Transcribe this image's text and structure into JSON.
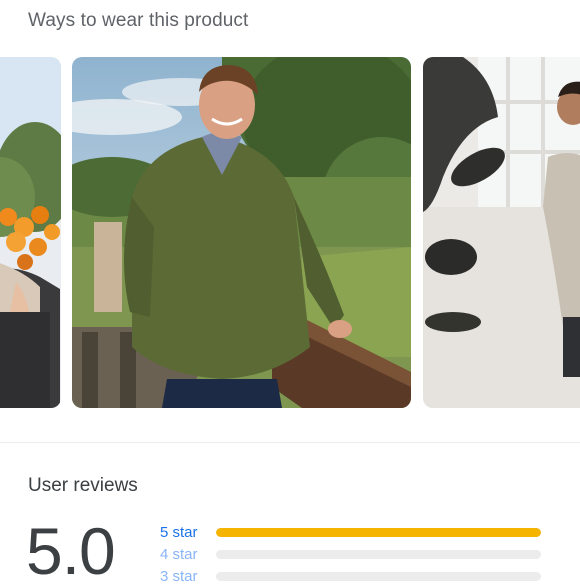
{
  "ways_section": {
    "title": "Ways to wear this product",
    "cards": [
      {
        "subject": "man-seated-with-orange-flowers"
      },
      {
        "subject": "man-in-green-fleece-by-fence"
      },
      {
        "subject": "man-in-white-room-with-plant"
      }
    ]
  },
  "reviews": {
    "title": "User reviews",
    "average": "5.0",
    "accent_color": "#f4b400",
    "distribution": [
      {
        "label": "5 star",
        "fraction": 1.0
      },
      {
        "label": "4 star",
        "fraction": 0
      },
      {
        "label": "3 star",
        "fraction": 0
      }
    ]
  }
}
